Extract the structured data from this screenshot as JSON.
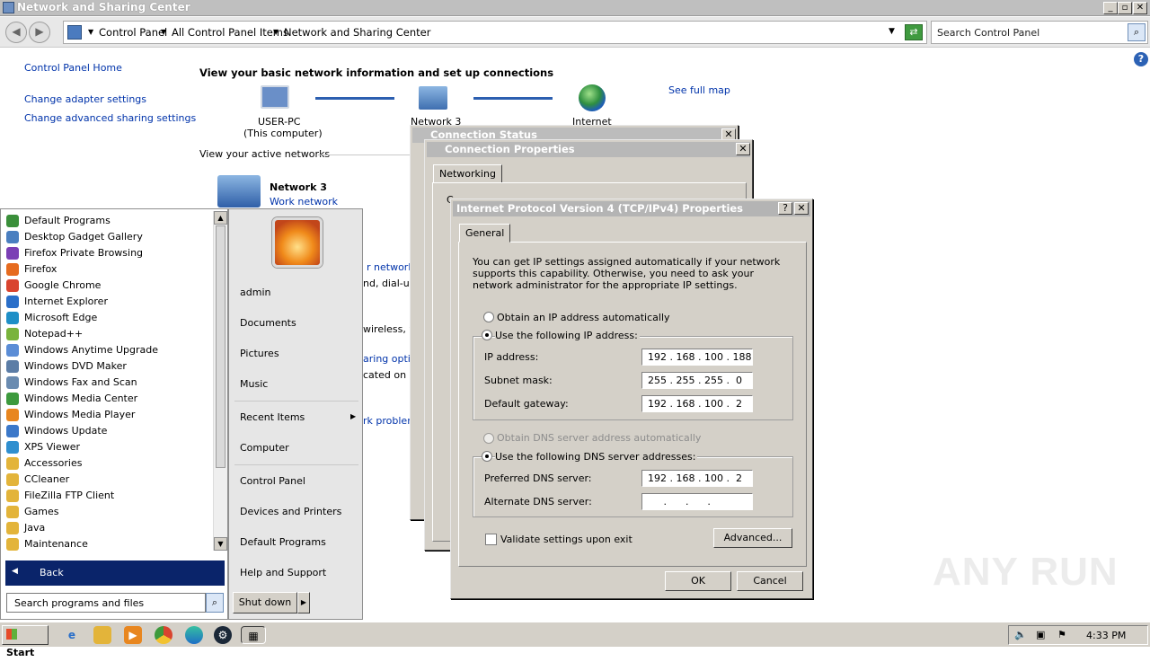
{
  "window": {
    "title": "Network and Sharing Center"
  },
  "address": {
    "segments": [
      "Control Panel",
      "All Control Panel Items",
      "Network and Sharing Center"
    ],
    "search_placeholder": "Search Control Panel"
  },
  "left_nav": {
    "home": "Control Panel Home",
    "links": [
      "Change adapter settings",
      "Change advanced sharing settings"
    ]
  },
  "main": {
    "heading": "View your basic network information and set up connections",
    "see_full_map": "See full map",
    "map": {
      "pc_name": "USER-PC",
      "pc_sub": "(This computer)",
      "network_name": "Network  3",
      "internet": "Internet"
    },
    "active_networks_label": "View your active networks",
    "active_network": {
      "name": "Network  3",
      "type": "Work network"
    },
    "partial_texts": [
      "r network",
      "nd, dial-up",
      "wireless, w",
      "aring optio",
      "cated on o",
      "rk problem"
    ]
  },
  "status_dialog": {
    "title": "Connection Status"
  },
  "properties_dialog": {
    "title": "Connection Properties",
    "tab": "Networking",
    "partial": "C"
  },
  "ipv4_dialog": {
    "title": "Internet Protocol Version 4 (TCP/IPv4) Properties",
    "help": "?",
    "tab": "General",
    "description": "You can get IP settings assigned automatically if your network supports this capability. Otherwise, you need to ask your network administrator for the appropriate IP settings.",
    "obtain_ip_auto": "Obtain an IP address automatically",
    "use_following_ip": "Use the following IP address:",
    "ip_label": "IP address:",
    "ip_value": "192 . 168 . 100 . 188",
    "subnet_label": "Subnet mask:",
    "subnet_value": "255 . 255 . 255 .  0",
    "gateway_label": "Default gateway:",
    "gateway_value": "192 . 168 . 100 .  2",
    "obtain_dns_auto": "Obtain DNS server address automatically",
    "use_following_dns": "Use the following DNS server addresses:",
    "pref_dns_label": "Preferred DNS server:",
    "pref_dns_value": "192 . 168 . 100 .  2",
    "alt_dns_label": "Alternate DNS server:",
    "alt_dns_value": "     .      .      .",
    "validate_label": "Validate settings upon exit",
    "advanced": "Advanced...",
    "ok": "OK",
    "cancel": "Cancel"
  },
  "start_menu": {
    "programs": [
      {
        "label": "Default Programs",
        "color": "#3a8f3a"
      },
      {
        "label": "Desktop Gadget Gallery",
        "color": "#4a7fc0"
      },
      {
        "label": "Firefox Private Browsing",
        "color": "#7b3fb5"
      },
      {
        "label": "Firefox",
        "color": "#e66b1f"
      },
      {
        "label": "Google Chrome",
        "color": "#d9442f"
      },
      {
        "label": "Internet Explorer",
        "color": "#2a6fc9"
      },
      {
        "label": "Microsoft Edge",
        "color": "#1e8fc7"
      },
      {
        "label": "Notepad++",
        "color": "#79b33c"
      },
      {
        "label": "Windows Anytime Upgrade",
        "color": "#5b8dd6"
      },
      {
        "label": "Windows DVD Maker",
        "color": "#5c7da6"
      },
      {
        "label": "Windows Fax and Scan",
        "color": "#6a8bb0"
      },
      {
        "label": "Windows Media Center",
        "color": "#3d9a3d"
      },
      {
        "label": "Windows Media Player",
        "color": "#e8861f"
      },
      {
        "label": "Windows Update",
        "color": "#3b78c9"
      },
      {
        "label": "XPS Viewer",
        "color": "#2f8fcf"
      },
      {
        "label": "Accessories",
        "color": "#e3b43a"
      },
      {
        "label": "CCleaner",
        "color": "#e3b43a"
      },
      {
        "label": "FileZilla FTP Client",
        "color": "#e3b43a"
      },
      {
        "label": "Games",
        "color": "#e3b43a"
      },
      {
        "label": "Java",
        "color": "#e3b43a"
      },
      {
        "label": "Maintenance",
        "color": "#e3b43a"
      }
    ],
    "back": "Back",
    "search_placeholder": "Search programs and files",
    "right_items": [
      "admin",
      "Documents",
      "Pictures",
      "Music",
      "Recent Items",
      "Computer",
      "Control Panel",
      "Devices and Printers",
      "Default Programs",
      "Help and Support"
    ],
    "shutdown": "Shut down"
  },
  "taskbar": {
    "start": "Start",
    "time": "4:33 PM"
  },
  "watermark": "ANY RUN"
}
